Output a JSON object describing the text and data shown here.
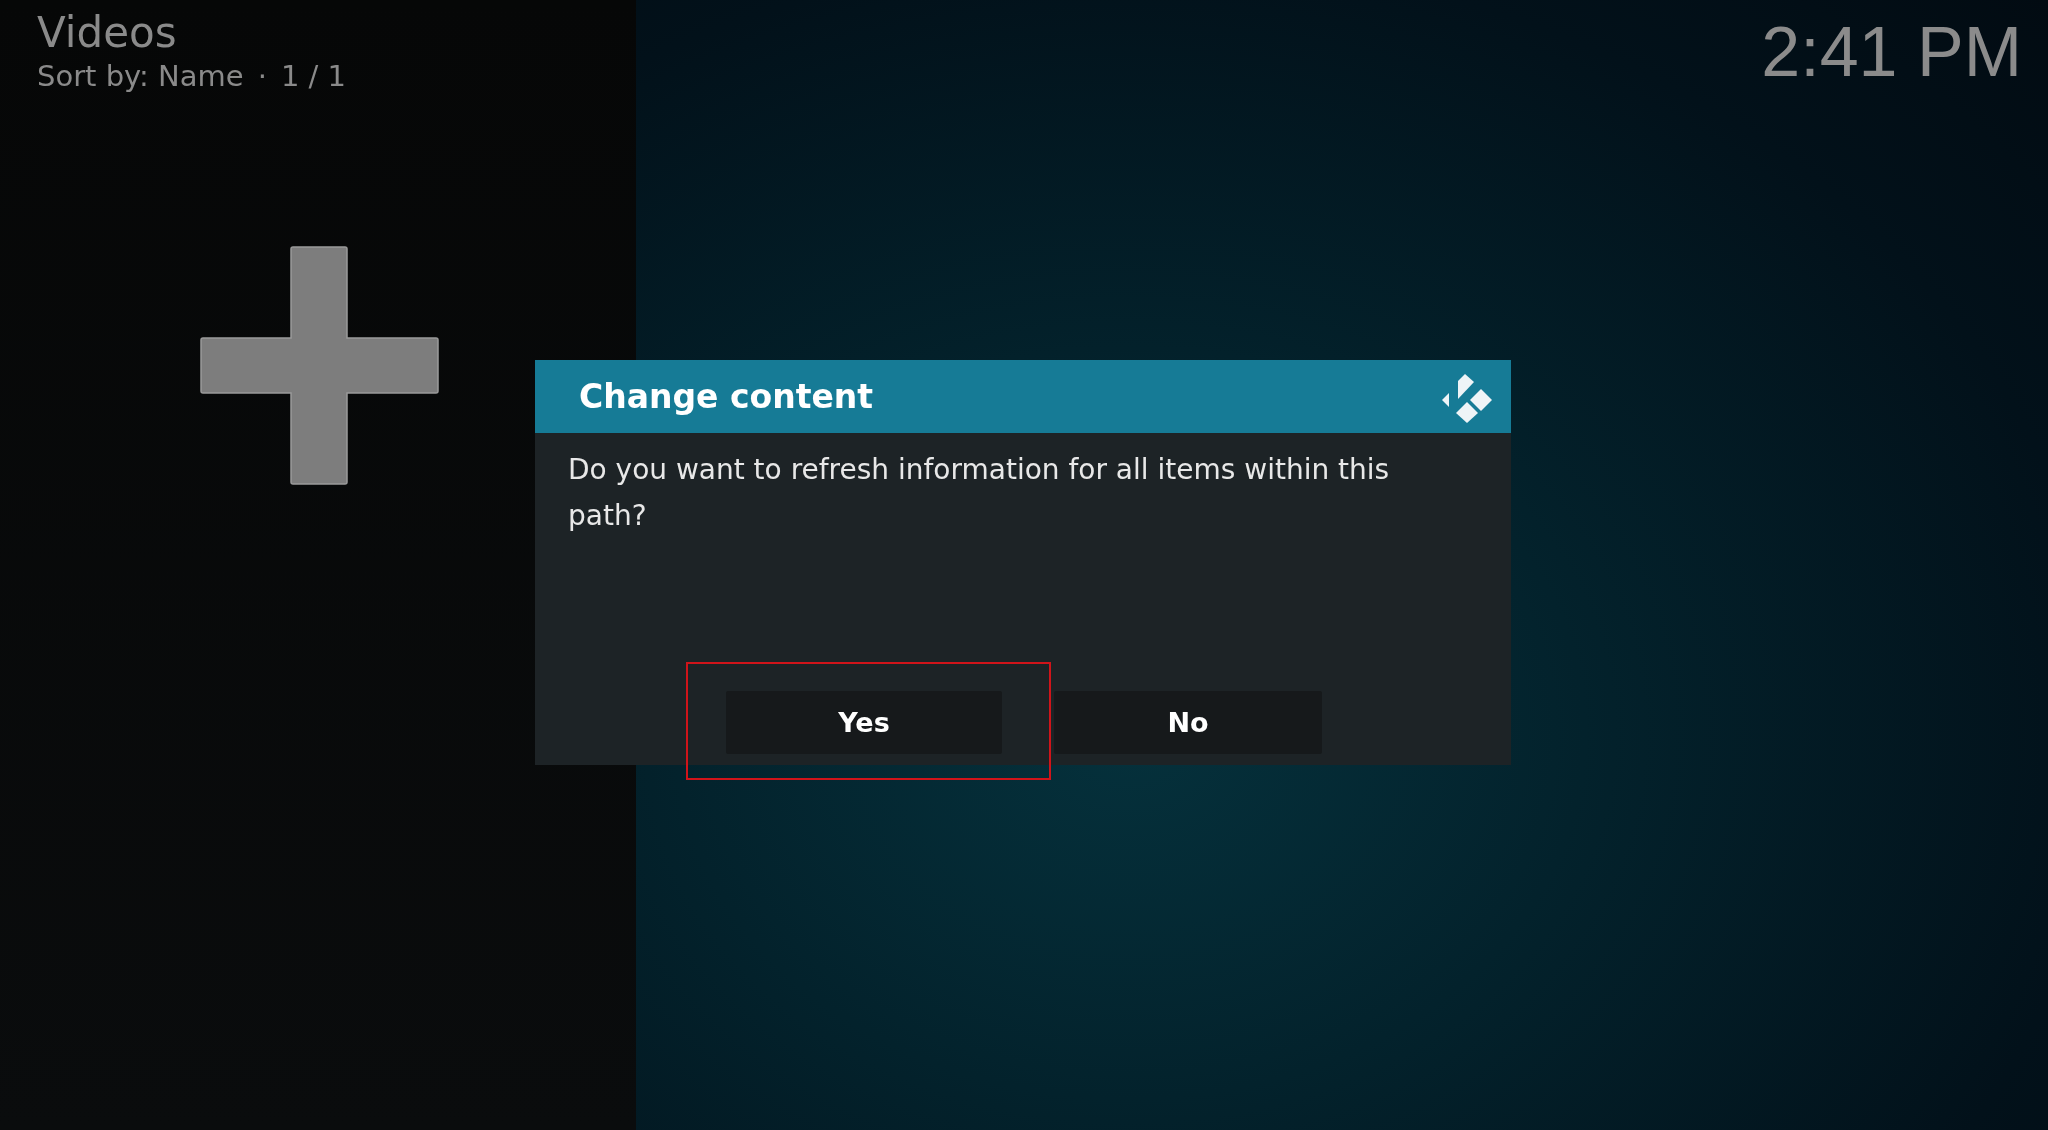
{
  "header": {
    "title": "Videos",
    "sort_label": "Sort by: Name",
    "separator": "·",
    "position": "1 / 1"
  },
  "clock": "2:41 PM",
  "dialog": {
    "title": "Change content",
    "message": "Do you want to refresh information for all items within this path?",
    "buttons": [
      {
        "label": "Yes",
        "highlighted": true
      },
      {
        "label": "No",
        "highlighted": false
      }
    ]
  }
}
